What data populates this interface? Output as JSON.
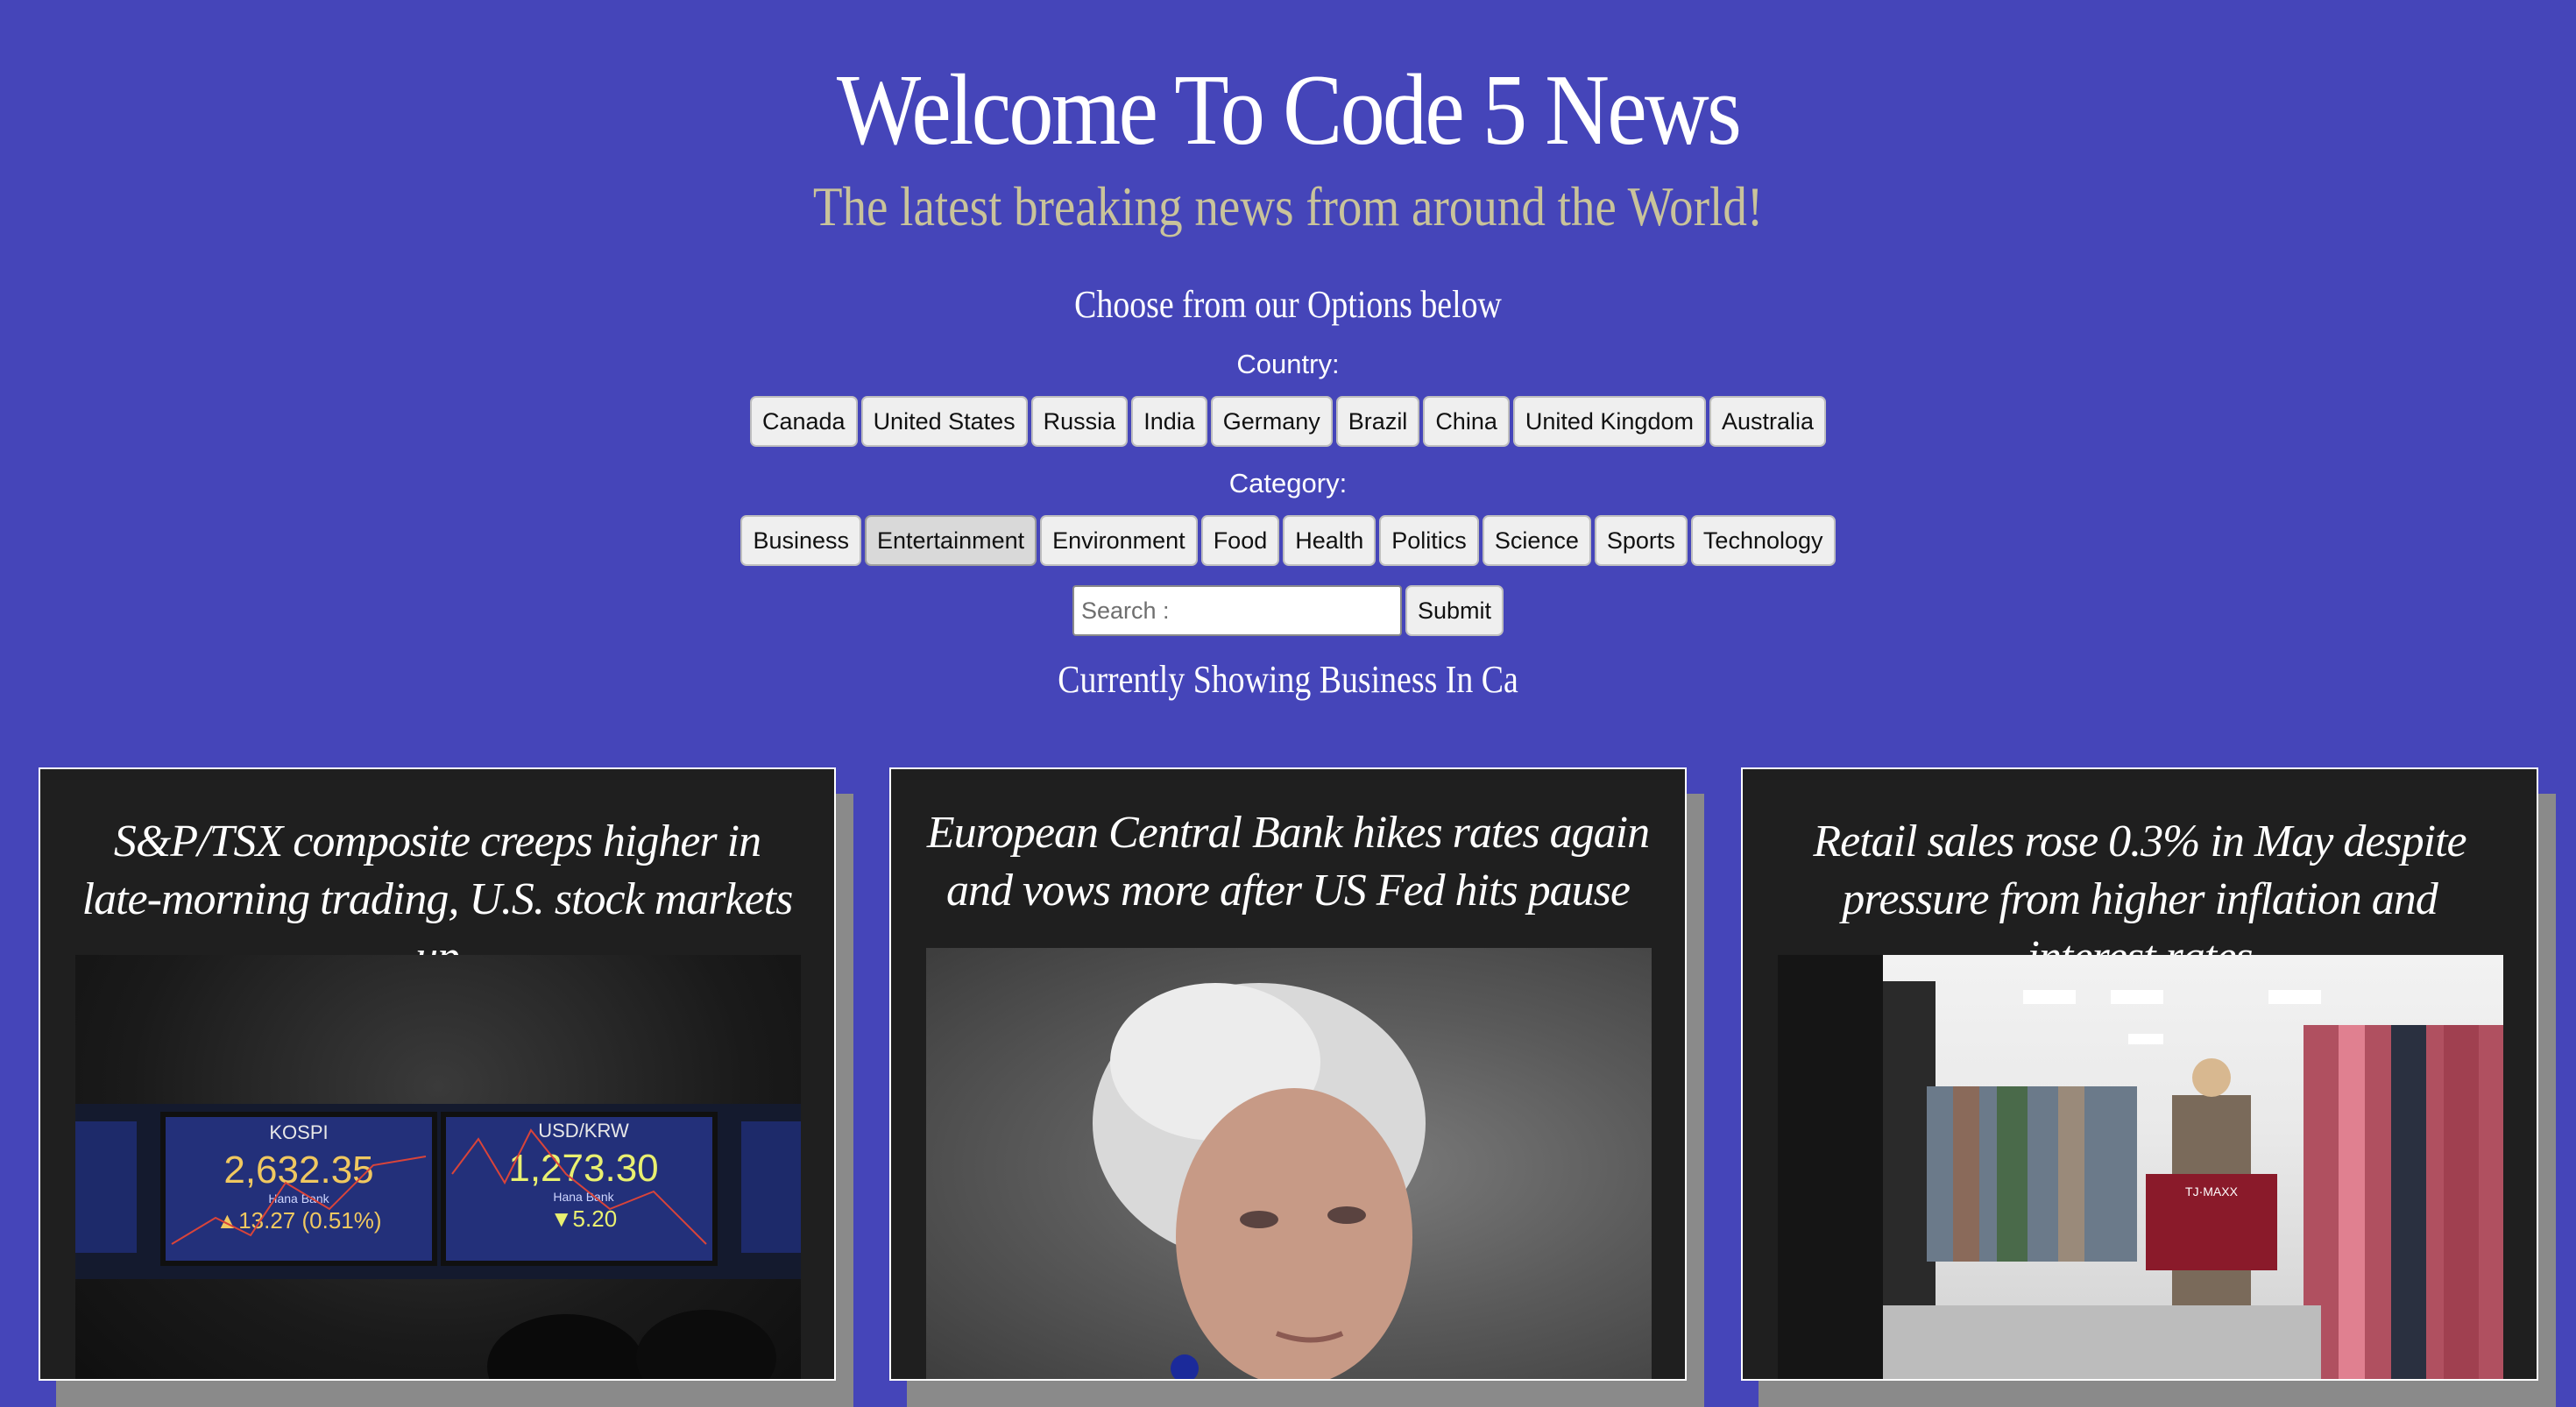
{
  "header": {
    "title": "Welcome To Code 5 News",
    "tagline": "The latest breaking news from around the World!",
    "choose_text": "Choose from our Options below"
  },
  "country": {
    "label": "Country:",
    "options": [
      "Canada",
      "United States",
      "Russia",
      "India",
      "Germany",
      "Brazil",
      "China",
      "United Kingdom",
      "Australia"
    ]
  },
  "category": {
    "label": "Category:",
    "options": [
      "Business",
      "Entertainment",
      "Environment",
      "Food",
      "Health",
      "Politics",
      "Science",
      "Sports",
      "Technology"
    ],
    "highlighted": "Entertainment"
  },
  "search": {
    "placeholder": "Search :",
    "submit_label": "Submit"
  },
  "status": {
    "showing_text": "Currently Showing Business In Ca"
  },
  "articles": [
    {
      "title": "S&P/TSX composite creeps higher in late-morning trading, U.S. stock markets up",
      "image": {
        "kospi_label": "KOSPI",
        "kospi_value": "2,632.35",
        "kospi_change": "▲13.27  (0.51%)",
        "fx_label": "USD/KRW",
        "fx_value": "1,273.30",
        "fx_change": "▼5.20",
        "bank": "Hana Bank"
      }
    },
    {
      "title": "European Central Bank hikes rates again and vows more after US Fed hits pause"
    },
    {
      "title": "Retail sales rose 0.3% in May despite pressure from higher inflation and interest rates",
      "image": {
        "cart_brand": "TJ·MAXX"
      }
    }
  ],
  "colors": {
    "background": "#4545b9",
    "tagline": "#c9c39a",
    "card": "#1f1f1f"
  }
}
